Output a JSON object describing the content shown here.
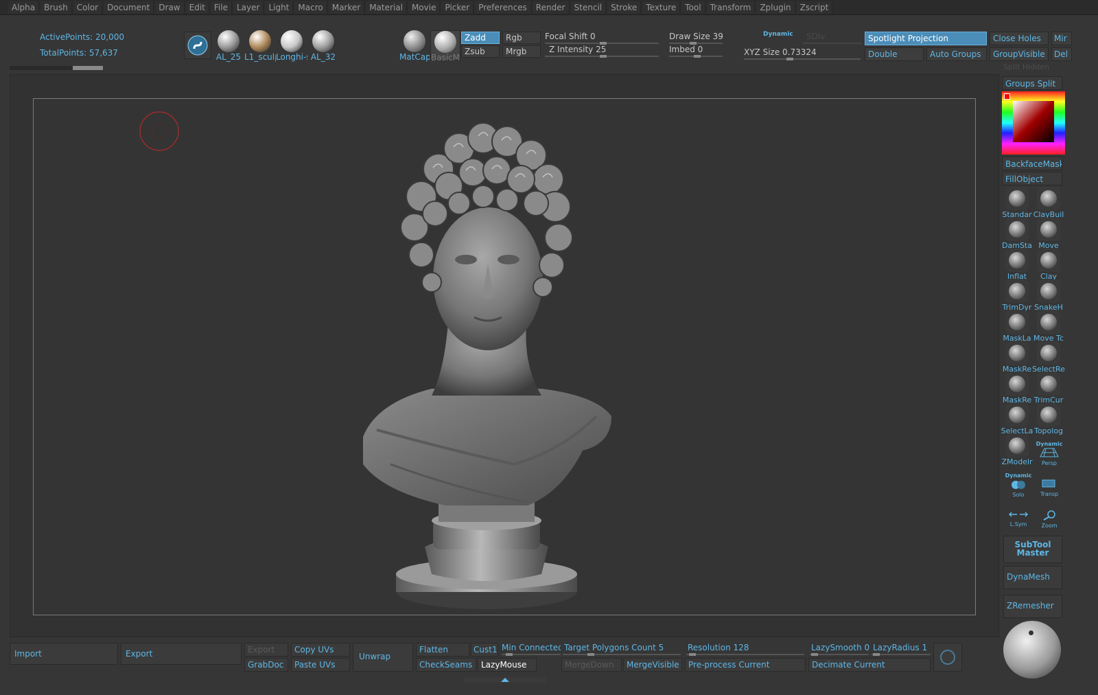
{
  "menu": [
    "Alpha",
    "Brush",
    "Color",
    "Document",
    "Draw",
    "Edit",
    "File",
    "Layer",
    "Light",
    "Macro",
    "Marker",
    "Material",
    "Movie",
    "Picker",
    "Preferences",
    "Render",
    "Stencil",
    "Stroke",
    "Texture",
    "Tool",
    "Transform",
    "Zplugin",
    "Zscript"
  ],
  "stats": {
    "active_points": "ActivePoints: 20,000",
    "total_points": "TotalPoints: 57,637"
  },
  "materials": [
    {
      "label": "AL_25",
      "color": "#9b9b9b"
    },
    {
      "label": "L1_sculp",
      "color": "#b08a5c"
    },
    {
      "label": "Longhi-s",
      "color": "#c8c8c8"
    },
    {
      "label": "AL_32",
      "color": "#a0a0a0"
    }
  ],
  "matcap": {
    "matcap_label": "MatCap",
    "basic_label": "BasicMa"
  },
  "modes": {
    "zadd": "Zadd",
    "zsub": "Zsub",
    "rgb": "Rgb",
    "mrgb": "Mrgb"
  },
  "sliders": {
    "focal_shift": "Focal Shift 0",
    "z_intensity": "Z Intensity 25",
    "draw_size": "Draw Size 39",
    "dynamic": "Dynamic",
    "sdiv": "SDiv",
    "imbed": "Imbed 0",
    "xyz_size": "XYZ Size 0.73324"
  },
  "topright": {
    "spotlight": "Spotlight Projection",
    "close_holes": "Close Holes",
    "mir": "Mir",
    "double": "Double",
    "auto_groups": "Auto Groups",
    "group_visible": "GroupVisible",
    "del": "Del",
    "split_hidden": "Split Hidden"
  },
  "right_shelf": {
    "groups_split": "Groups Split",
    "backface_mask": "BackfaceMask",
    "fill_object": "FillObject",
    "brushes": [
      {
        "label": "Standar",
        "icon": "standard-brush-icon"
      },
      {
        "label": "ClayBuil",
        "icon": "claybuildup-brush-icon"
      },
      {
        "label": "DamSta",
        "icon": "damstandard-brush-icon"
      },
      {
        "label": "Move",
        "icon": "move-brush-icon"
      },
      {
        "label": "Inflat",
        "icon": "inflate-brush-icon"
      },
      {
        "label": "Clay",
        "icon": "clay-brush-icon"
      },
      {
        "label": "TrimDyr",
        "icon": "trimdynamic-brush-icon"
      },
      {
        "label": "SnakeH",
        "icon": "snakehook-brush-icon"
      },
      {
        "label": "MaskLa",
        "icon": "masklasso-brush-icon"
      },
      {
        "label": "Move Tc",
        "icon": "movetopological-brush-icon"
      },
      {
        "label": "MaskRe",
        "icon": "maskrect-brush-icon"
      },
      {
        "label": "SelectRe",
        "icon": "selectrect-brush-icon"
      },
      {
        "label": "MaskRe",
        "icon": "maskrect2-brush-icon"
      },
      {
        "label": "TrimCur",
        "icon": "trimcurve-brush-icon"
      },
      {
        "label": "SelectLa",
        "icon": "selectlasso-brush-icon"
      },
      {
        "label": "Topolog",
        "icon": "topology-brush-icon"
      },
      {
        "label": "ZModelr",
        "icon": "zmodeler-brush-icon"
      }
    ],
    "persp_dynamic": "Dynamic",
    "persp": "Persp",
    "solo_dynamic": "Dynamic",
    "solo": "Solo",
    "transp": "Transp",
    "lsym": "L.Sym",
    "zoom": "Zoom",
    "subtool_master_1": "SubTool",
    "subtool_master_2": "Master",
    "dynamesh": "DynaMesh",
    "zremesher": "ZRemesher"
  },
  "bottom": {
    "import": "Import",
    "export": "Export",
    "export2": "Export",
    "copy_uvs": "Copy UVs",
    "grabdoc": "GrabDoc",
    "paste_uvs": "Paste UVs",
    "unwrap": "Unwrap",
    "flatten": "Flatten",
    "cust1": "Cust1",
    "checkseams": "CheckSeams",
    "lazymouse": "LazyMouse",
    "min_connected": "Min Connected I",
    "target_polys": "Target Polygons Count 5",
    "resolution": "Resolution 128",
    "mergedown": "MergeDown",
    "mergevisible": "MergeVisible",
    "preprocess": "Pre-process Current",
    "lazysmooth": "LazySmooth 0",
    "lazyradius": "LazyRadius 1",
    "decimate": "Decimate Current"
  }
}
